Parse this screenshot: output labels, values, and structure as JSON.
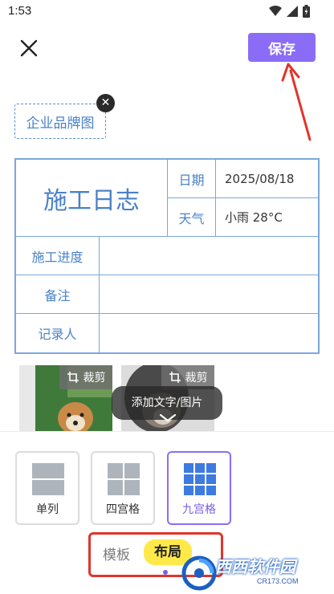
{
  "status_bar": {
    "time": "1:53"
  },
  "top_bar": {
    "save_label": "保存"
  },
  "brand_tag": {
    "label": "企业品牌图",
    "remove_icon": "close-circle-icon"
  },
  "log_table": {
    "title": "施工日志",
    "date_label": "日期",
    "date_value": "2025/08/18",
    "weather_label": "天气",
    "weather_value": "小雨 28°C",
    "rows": [
      {
        "label": "施工进度",
        "value": ""
      },
      {
        "label": "备注",
        "value": ""
      },
      {
        "label": "记录人",
        "value": ""
      }
    ]
  },
  "photos": [
    {
      "crop_label": "裁剪"
    },
    {
      "crop_label": "裁剪"
    }
  ],
  "add_overlay": {
    "label": "添加文字/图片"
  },
  "layouts": [
    {
      "label": "单列",
      "selected": false
    },
    {
      "label": "四宫格",
      "selected": false
    },
    {
      "label": "九宫格",
      "selected": true
    }
  ],
  "tabs": {
    "template_label": "模板",
    "layout_label": "布局",
    "active": "布局"
  },
  "watermark": {
    "text": "西西软件园",
    "sub": "CR173.COM"
  },
  "colors": {
    "accent": "#8b6cf6",
    "table_border": "#7ba7dc",
    "table_text": "#4a82c8",
    "highlight": "#ffe94a",
    "annotation_red": "#e0352b"
  }
}
